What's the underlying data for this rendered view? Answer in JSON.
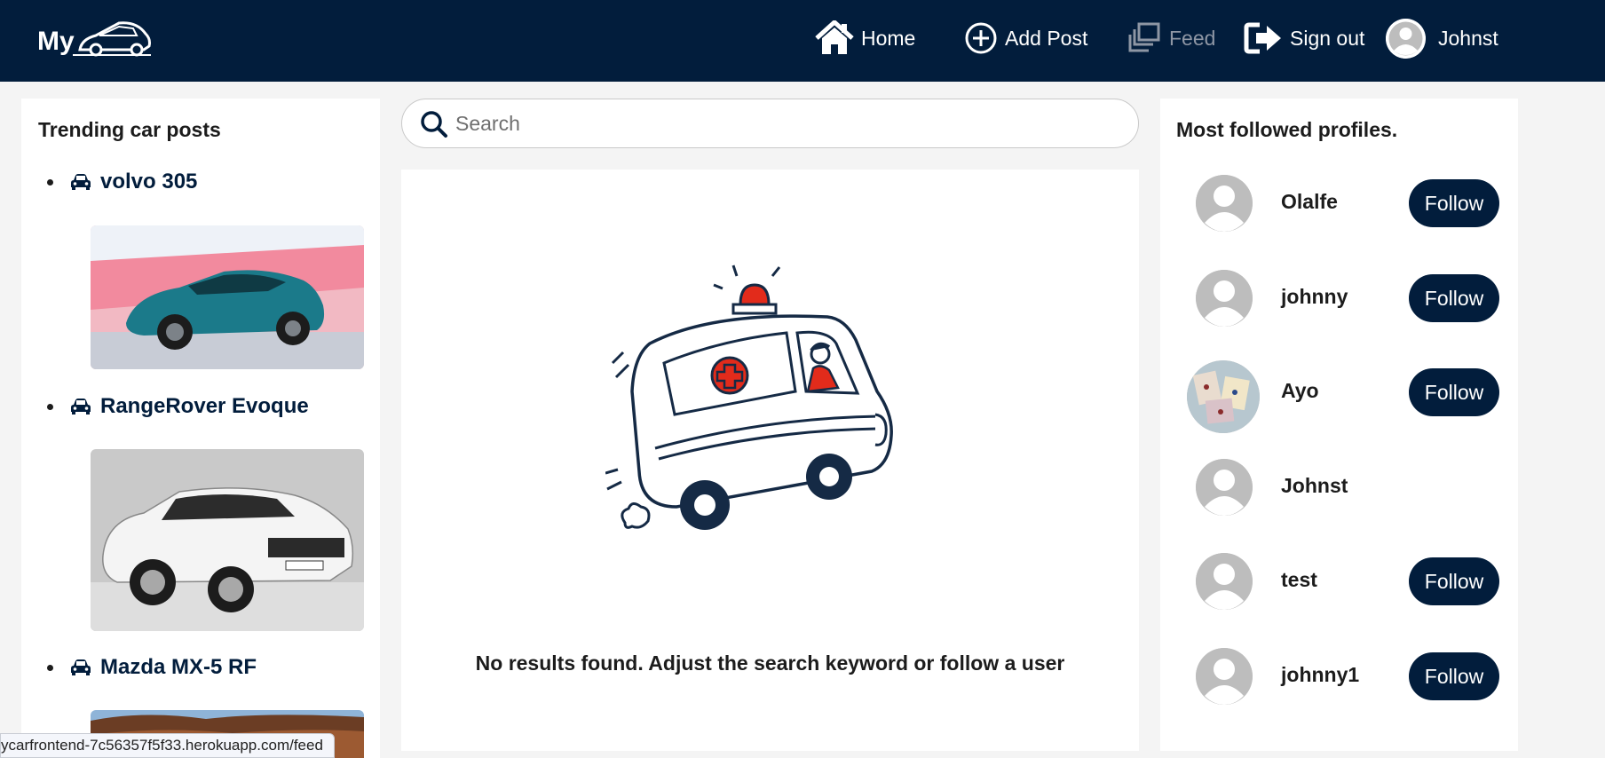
{
  "nav": {
    "home": "Home",
    "add_post": "Add Post",
    "feed": "Feed",
    "sign_out": "Sign out",
    "username": "Johnst"
  },
  "trending": {
    "title": "Trending car posts",
    "items": [
      {
        "label": "volvo 305",
        "icon": "car-icon",
        "image": "teal-suv-photo"
      },
      {
        "label": "RangeRover Evoque",
        "icon": "car-icon",
        "image": "white-suv-photo"
      },
      {
        "label": "Mazda MX-5 RF",
        "icon": "car-icon",
        "image": "desert-landscape-photo"
      }
    ]
  },
  "search": {
    "placeholder": "Search",
    "value": ""
  },
  "feed": {
    "empty_message": "No results found. Adjust the search keyword or follow a user"
  },
  "profiles": {
    "title": "Most followed profiles.",
    "follow_label": "Follow",
    "items": [
      {
        "name": "Olalfe",
        "avatar": "default",
        "follow": true
      },
      {
        "name": "johnny",
        "avatar": "default",
        "follow": true
      },
      {
        "name": "Ayo",
        "avatar": "photo",
        "follow": true
      },
      {
        "name": "Johnst",
        "avatar": "default",
        "follow": false
      },
      {
        "name": "test",
        "avatar": "default",
        "follow": true
      },
      {
        "name": "johnny1",
        "avatar": "default",
        "follow": true
      }
    ]
  },
  "status_url": "ycarfrontend-7c56357f5f33.herokuapp.com/feed",
  "colors": {
    "nav_bg": "#021d3c",
    "accent": "#021d3c",
    "page_bg": "#f4f4f4",
    "alert_red": "#e22b1b"
  }
}
